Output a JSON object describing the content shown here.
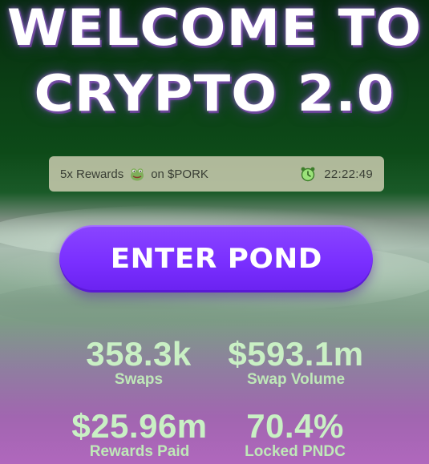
{
  "headline": {
    "line1": "WELCOME TO",
    "line2": "CRYPTO 2.0"
  },
  "rewards_bar": {
    "prefix": "5x Rewards",
    "suffix": "on $PORK",
    "timer": "22:22:49",
    "icons": [
      "frog-icon",
      "alarm-clock-icon"
    ]
  },
  "cta": {
    "label": "ENTER POND"
  },
  "stats": [
    {
      "value": "358.3k",
      "label": "Swaps"
    },
    {
      "value": "$593.1m",
      "label": "Swap Volume"
    },
    {
      "value": "$25.96m",
      "label": "Rewards Paid"
    },
    {
      "value": "70.4%",
      "label": "Locked PNDC"
    }
  ],
  "colors": {
    "button": "#7a2fff",
    "stat_text": "#c9f0c4",
    "bar_bg": "#dcd7be"
  }
}
